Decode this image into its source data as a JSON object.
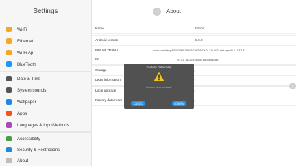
{
  "sidebar": {
    "title": "Settings",
    "items": [
      {
        "label": "Wi-Fi",
        "icon": "wifi-icon",
        "color": "#f5a623"
      },
      {
        "label": "Ethernet",
        "icon": "ethernet-icon",
        "color": "#f5a623"
      },
      {
        "label": "Wi-Fi Ap",
        "icon": "hotspot-icon",
        "color": "#f5a623"
      },
      {
        "label": "BlueTooth",
        "icon": "bluetooth-icon",
        "color": "#2196f3"
      },
      {
        "label": "Date & Time",
        "icon": "clock-icon",
        "color": "#555555"
      },
      {
        "label": "System sounds",
        "icon": "sound-icon",
        "color": "#555555"
      },
      {
        "label": "Wallpaper",
        "icon": "wallpaper-icon",
        "color": "#1e88e5"
      },
      {
        "label": "Apps",
        "icon": "apps-icon",
        "color": "#f4511e"
      },
      {
        "label": "Languages & InputMethods",
        "icon": "language-icon",
        "color": "#ab47bc"
      },
      {
        "label": "Accessibility",
        "icon": "accessibility-icon",
        "color": "#43a047"
      },
      {
        "label": "Security & Restrictions",
        "icon": "security-icon",
        "color": "#1e88e5"
      },
      {
        "label": "About",
        "icon": "about-icon",
        "color": "#bdbdbd"
      }
    ]
  },
  "main": {
    "title": "About",
    "rows": [
      {
        "label": "Name",
        "value": "horion"
      },
      {
        "label": "Android version",
        "value": "8.0.0"
      },
      {
        "label": "Internal version",
        "value": "horion-userdebug 8.0.0 OPR6.170623.019 TVBOX-24.310.84.01 test-keys V1.2.17-P.2.32"
      },
      {
        "label": "ID",
        "value": "V1.0.1_88C6CA750853_88D0198008A"
      },
      {
        "label": "Storage",
        "value": ""
      },
      {
        "label": "Legal information",
        "value": ""
      },
      {
        "label": "Local upgrade",
        "value": ""
      },
      {
        "label": "Factory data reset",
        "value": ""
      }
    ]
  },
  "dialog": {
    "title": "Factory data reset",
    "message": "Confirm clear all data?",
    "cancel": "CANCEL",
    "confirm": "CONFIRM",
    "warning_color": "#f5c518"
  },
  "accent_color": "#2196f3"
}
